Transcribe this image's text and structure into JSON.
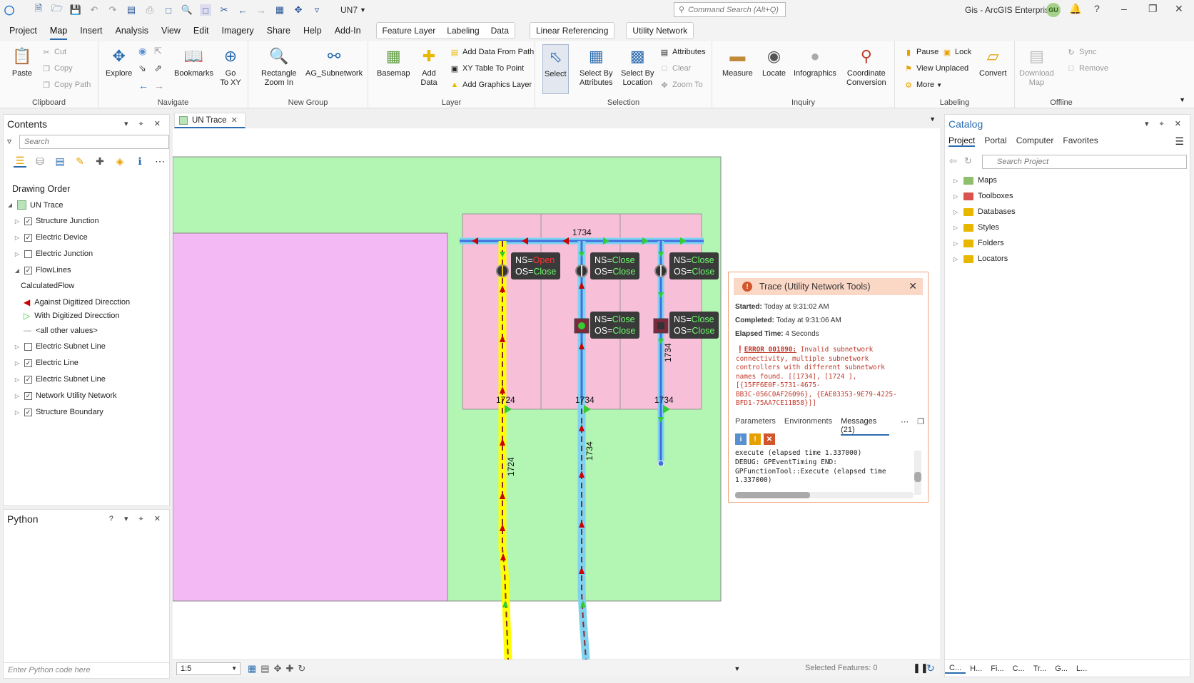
{
  "titlebar": {
    "doc_title": "UN7",
    "command_search_placeholder": "Command Search (Alt+Q)",
    "app_title": "Gis - ArcGIS Enterprise",
    "user_initials": "GU"
  },
  "menu": {
    "items": [
      "Project",
      "Map",
      "Insert",
      "Analysis",
      "View",
      "Edit",
      "Imagery",
      "Share",
      "Help",
      "Add-In"
    ],
    "active": "Map",
    "feature_layer_group": [
      "Feature Layer",
      "Labeling",
      "Data"
    ],
    "linear_referencing": "Linear Referencing",
    "utility_network": "Utility Network"
  },
  "ribbon": {
    "clipboard": {
      "label": "Clipboard",
      "paste": "Paste",
      "cut": "Cut",
      "copy": "Copy",
      "copy_path": "Copy Path"
    },
    "navigate": {
      "label": "Navigate",
      "explore": "Explore",
      "bookmarks": "Bookmarks",
      "go_to_xy": "Go\nTo XY"
    },
    "new_group": {
      "label": "New Group",
      "rect_zoom": "Rectangle\nZoom In",
      "ag_subnetwork": "AG_Subnetwork"
    },
    "layer": {
      "label": "Layer",
      "basemap": "Basemap",
      "add_data": "Add\nData",
      "add_data_from_path": "Add Data From Path",
      "xy_table": "XY Table To Point",
      "add_graphics": "Add Graphics Layer"
    },
    "selection": {
      "label": "Selection",
      "select": "Select",
      "select_by_attr": "Select By\nAttributes",
      "select_by_loc": "Select By\nLocation",
      "attributes": "Attributes",
      "clear": "Clear",
      "zoom_to": "Zoom To"
    },
    "inquiry": {
      "label": "Inquiry",
      "measure": "Measure",
      "locate": "Locate",
      "infographics": "Infographics",
      "coord_conv": "Coordinate\nConversion"
    },
    "labeling": {
      "label": "Labeling",
      "pause": "Pause",
      "lock": "Lock",
      "view_unplaced": "View Unplaced",
      "more": "More",
      "convert": "Convert"
    },
    "offline": {
      "label": "Offline",
      "download_map": "Download\nMap",
      "sync": "Sync",
      "remove": "Remove"
    }
  },
  "contents": {
    "title": "Contents",
    "search_placeholder": "Search",
    "drawing_order": "Drawing Order",
    "map_name": "UN Trace",
    "layers": [
      {
        "name": "Structure Junction",
        "checked": true
      },
      {
        "name": "Electric Device",
        "checked": true
      },
      {
        "name": "Electric Junction",
        "checked": false
      },
      {
        "name": "FlowLines",
        "checked": true
      },
      {
        "name": "Electric Subnet Line",
        "checked": false
      },
      {
        "name": "Electric Line",
        "checked": true
      },
      {
        "name": "Electric Subnet Line",
        "checked": true
      },
      {
        "name": "Network Utility Network",
        "checked": true
      },
      {
        "name": "Structure Boundary",
        "checked": true
      }
    ],
    "flowlines_field": "CalculatedFlow",
    "legend": [
      "Against Digitized Direcction",
      "With Digitized Direcction",
      "<all other values>"
    ]
  },
  "python": {
    "title": "Python",
    "input_placeholder": "Enter Python code here"
  },
  "map": {
    "tab_title": "UN Trace",
    "scale": "1:5",
    "selected_features": "Selected Features: 0",
    "line_labels": [
      "1734",
      "1724",
      "1734",
      "1734",
      "1724",
      "1734",
      "1734"
    ],
    "device_labels": [
      {
        "ns_key": "NS=",
        "ns_val": "Open",
        "os_key": "OS=",
        "os_val": "Close"
      },
      {
        "ns_key": "NS=",
        "ns_val": "Close",
        "os_key": "OS=",
        "os_val": "Close"
      },
      {
        "ns_key": "NS=",
        "ns_val": "Close",
        "os_key": "OS=",
        "os_val": "Close"
      },
      {
        "ns_key": "NS=",
        "ns_val": "Close",
        "os_key": "OS=",
        "os_val": "Close"
      },
      {
        "ns_key": "NS=",
        "ns_val": "Close",
        "os_key": "OS=",
        "os_val": "Close"
      }
    ]
  },
  "trace": {
    "title": "Trace (Utility Network Tools)",
    "started_label": "Started:",
    "started": "Today at 9:31:02 AM",
    "completed_label": "Completed:",
    "completed": "Today at 9:31:06 AM",
    "elapsed_label": "Elapsed Time:",
    "elapsed": "4 Seconds",
    "error_code": "ERROR 001890:",
    "error_text": " Invalid subnetwork\nconnectivity, multiple subnetwork\ncontrollers with different subnetwork\nnames found. [[1734], [1724 ],\n[{15FF6E0F-5731-4675-\nBB3C-056C0AF26096}, {EAE03353-9E79-4225-\nBFD1-75AA7CE11B58}]]",
    "tabs": [
      "Parameters",
      "Environments",
      "Messages (21)"
    ],
    "log": "execute (elapsed time 1.337000)\nDEBUG: GPEventTiming END:\nGPFunctionTool::Execute (elapsed time\n1.337000)"
  },
  "catalog": {
    "title": "Catalog",
    "tabs": [
      "Project",
      "Portal",
      "Computer",
      "Favorites"
    ],
    "search_placeholder": "Search Project",
    "items": [
      "Maps",
      "Toolboxes",
      "Databases",
      "Styles",
      "Folders",
      "Locators"
    ],
    "bottom_tabs": [
      "C...",
      "H...",
      "Fi...",
      "C...",
      "Tr...",
      "G...",
      "L..."
    ]
  },
  "colors": {
    "green_area": "#b3f5b3",
    "pink_area": "#f7bfd8",
    "magenta_area": "#f3b9f5",
    "yellow_line": "#ffff00",
    "cyan_line": "#7fd3f0",
    "blue_line": "#3f6fe0",
    "accent": "#2b6cb0"
  }
}
